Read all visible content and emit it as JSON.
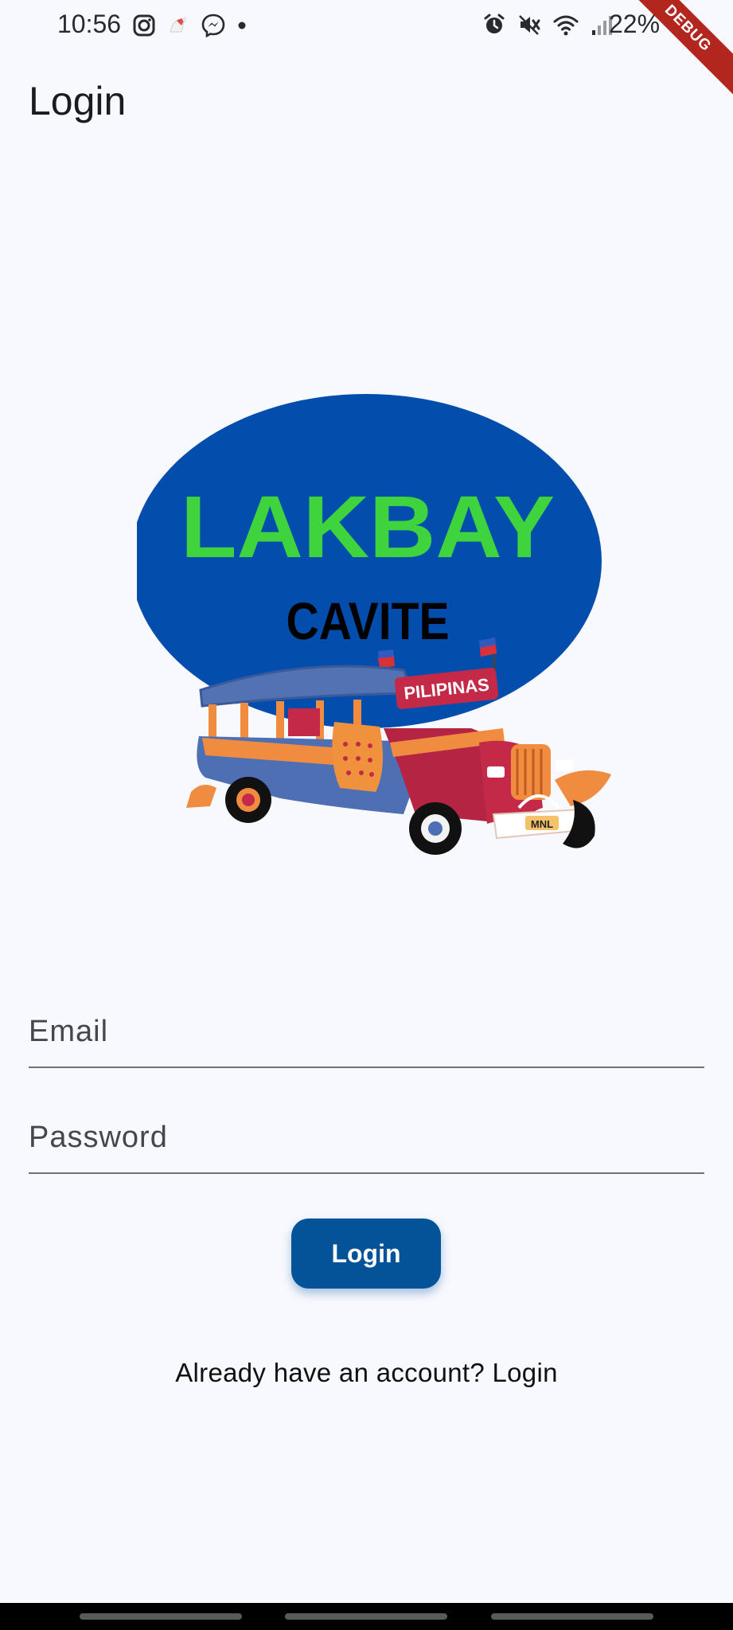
{
  "status_bar": {
    "time": "10:56",
    "battery": "22%",
    "left_icons": [
      "instagram-icon",
      "santa-hat-icon",
      "messenger-icon",
      "dot-icon"
    ],
    "right_icons": [
      "alarm-icon",
      "mute-icon",
      "wifi-icon",
      "signal-icon",
      "battery-icon"
    ]
  },
  "debug_banner": "DEBUG",
  "page": {
    "title": "Login"
  },
  "logo": {
    "title": "LAKBAY",
    "subtitle": "CAVITE",
    "sign": "PILIPINAS",
    "plate": "MNL",
    "colors": {
      "oval": "#034ead",
      "title": "#3fd43d",
      "subtitle": "#000000"
    }
  },
  "form": {
    "email_placeholder": "Email",
    "password_placeholder": "Password",
    "login_label": "Login"
  },
  "footer_link": "Already have an account? Login",
  "colors": {
    "background": "#f8f9fe",
    "primary": "#045399"
  }
}
